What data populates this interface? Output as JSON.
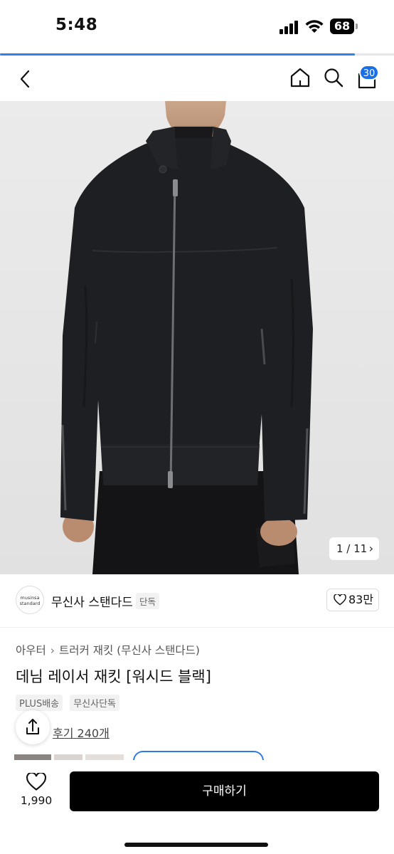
{
  "status_bar": {
    "time": "5:48",
    "battery": "68",
    "page_load_progress": 0.9
  },
  "nav": {
    "cart_count": "30"
  },
  "gallery": {
    "counter": "1 / 11"
  },
  "brand": {
    "logo_text_line1": "musinsa",
    "logo_text_line2": "standard",
    "name": "무신사 스탠다드",
    "tag": "단독",
    "likes": "83만"
  },
  "product": {
    "breadcrumb_category": "아우터",
    "breadcrumb_sub": "트러커 재킷 (무신사 스탠다드)",
    "title": "데님 레이서 재킷 [워시드 블랙]",
    "tags": [
      "PLUS배송",
      "무신사단독"
    ],
    "reviews": "후기 240개"
  },
  "bottom": {
    "wishlist_count": "1,990",
    "buy_label": "구매하기"
  },
  "colors": {
    "accent_blue": "#2f80ed",
    "badge_blue": "#1a6fe8",
    "buy_button": "#000000",
    "jacket": "#1e1f22"
  },
  "icons": [
    "back-icon",
    "home-icon",
    "search-icon",
    "bag-icon",
    "heart-icon",
    "share-icon",
    "chevron-right-icon"
  ]
}
